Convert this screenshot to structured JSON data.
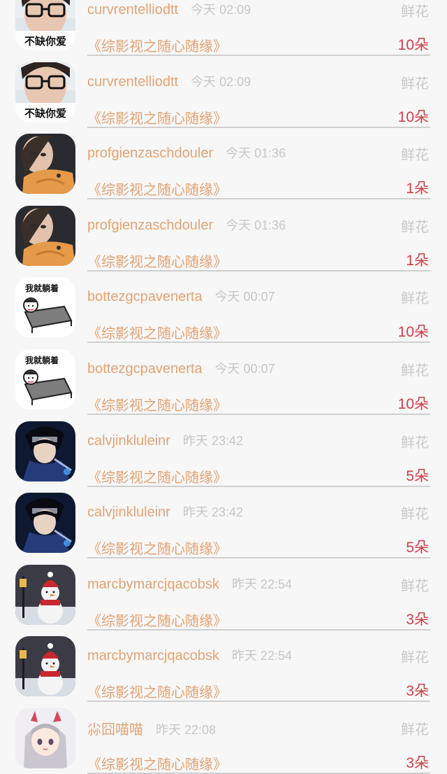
{
  "gift_label": "鲜花",
  "avatar_captions": {
    "glasses": "不缺你爱",
    "lying": "我就躺着"
  },
  "records": [
    {
      "user": "curvrentelliodtt",
      "time": "今天 02:09",
      "book": "《综影视之随心随缘》",
      "count": "10朵",
      "avatar": "glasses"
    },
    {
      "user": "curvrentelliodtt",
      "time": "今天 02:09",
      "book": "《综影视之随心随缘》",
      "count": "10朵",
      "avatar": "glasses"
    },
    {
      "user": "profgienzaschdouler",
      "time": "今天 01:36",
      "book": "《综影视之随心随缘》",
      "count": "1朵",
      "avatar": "cat-girl"
    },
    {
      "user": "profgienzaschdouler",
      "time": "今天 01:36",
      "book": "《综影视之随心随缘》",
      "count": "1朵",
      "avatar": "cat-girl"
    },
    {
      "user": "bottezgcpavenerta",
      "time": "今天 00:07",
      "book": "《综影视之随心随缘》",
      "count": "10朵",
      "avatar": "lying"
    },
    {
      "user": "bottezgcpavenerta",
      "time": "今天 00:07",
      "book": "《综影视之随心随缘》",
      "count": "10朵",
      "avatar": "lying"
    },
    {
      "user": "calvjinkluleinr",
      "time": "昨天 23:42",
      "book": "《综影视之随心随缘》",
      "count": "5朵",
      "avatar": "ninja"
    },
    {
      "user": "calvjinkluleinr",
      "time": "昨天 23:42",
      "book": "《综影视之随心随缘》",
      "count": "5朵",
      "avatar": "ninja"
    },
    {
      "user": "marcbymarcjqacobsk",
      "time": "昨天 22:54",
      "book": "《综影视之随心随缘》",
      "count": "3朵",
      "avatar": "snowman"
    },
    {
      "user": "marcbymarcjqacobsk",
      "time": "昨天 22:54",
      "book": "《综影视之随心随缘》",
      "count": "3朵",
      "avatar": "snowman"
    },
    {
      "user": "尛囧喵喵",
      "time": "昨天 22:08",
      "book": "《综影视之随心随缘》",
      "count": "3朵",
      "avatar": "anime-girl"
    }
  ]
}
